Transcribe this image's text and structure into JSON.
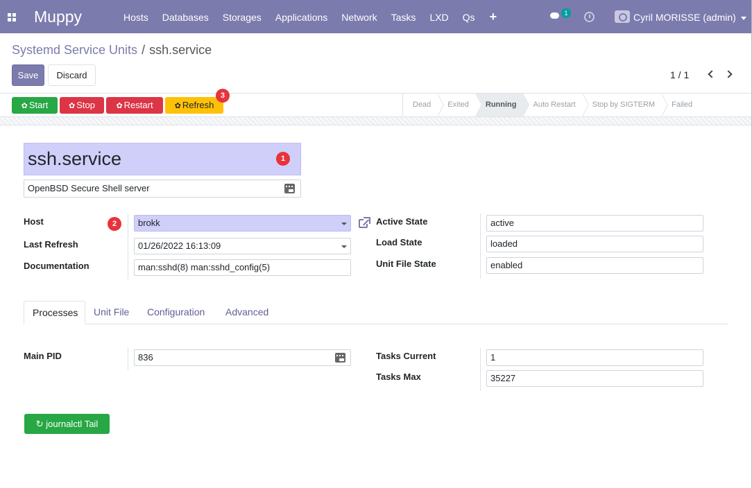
{
  "navbar": {
    "brand": "Muppy",
    "menu": [
      "Hosts",
      "Databases",
      "Storages",
      "Applications",
      "Network",
      "Tasks",
      "LXD",
      "Qs"
    ],
    "plus": "+",
    "chat_count": "1",
    "user": "Cyril MORISSE (admin)"
  },
  "breadcrumb": {
    "parent": "Systemd Service Units",
    "separator": "/",
    "current": "ssh.service"
  },
  "actions": {
    "save": "Save",
    "discard": "Discard"
  },
  "pager": {
    "value": "1 / 1"
  },
  "header_buttons": {
    "start": "Start",
    "stop": "Stop",
    "restart": "Restart",
    "refresh": "Refresh"
  },
  "statusbar": {
    "stages": [
      "Dead",
      "Exited",
      "Running",
      "Auto Restart",
      "Stop by SIGTERM",
      "Failed"
    ],
    "active": "Running"
  },
  "markers": [
    "1",
    "2",
    "3"
  ],
  "record": {
    "name": "ssh.service",
    "description": "OpenBSD Secure Shell server"
  },
  "fields_left": {
    "host_label": "Host",
    "host_value": "brokk",
    "last_refresh_label": "Last Refresh",
    "last_refresh_value": "01/26/2022 16:13:09",
    "documentation_label": "Documentation",
    "documentation_value": "man:sshd(8) man:sshd_config(5)"
  },
  "fields_right": {
    "active_state_label": "Active State",
    "active_state_value": "active",
    "load_state_label": "Load State",
    "load_state_value": "loaded",
    "unit_file_state_label": "Unit File State",
    "unit_file_state_value": "enabled"
  },
  "tabs": [
    "Processes",
    "Unit File",
    "Configuration",
    "Advanced"
  ],
  "processes": {
    "main_pid_label": "Main PID",
    "main_pid_value": "836",
    "tasks_current_label": "Tasks Current",
    "tasks_current_value": "1",
    "tasks_max_label": "Tasks Max",
    "tasks_max_value": "35227"
  },
  "journal_button": "journalctl Tail",
  "colors": {
    "navbar": "#7c7bad",
    "start": "#28a745",
    "stop": "#dc3545",
    "refresh": "#ffc107",
    "highlight": "#d0cffa",
    "marker": "#e8333b"
  }
}
